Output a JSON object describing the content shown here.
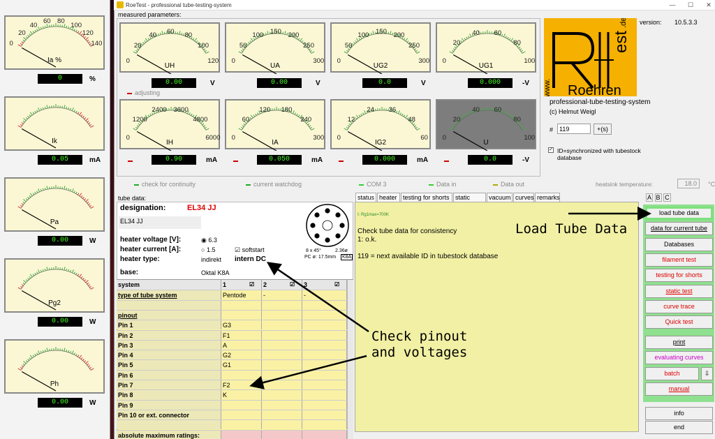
{
  "window": {
    "title": "RoeTest - professional tube-testing-system"
  },
  "left_meters": [
    {
      "label": "Ia %",
      "unit": "%",
      "value": "0",
      "ticks": [
        "0",
        "20",
        "40",
        "60",
        "80",
        "100",
        "120",
        "140"
      ]
    },
    {
      "label": "Ik",
      "unit": "mA",
      "value": "0.05"
    },
    {
      "label": "Pa",
      "unit": "W",
      "value": "0.00"
    },
    {
      "label": "Pg2",
      "unit": "W",
      "value": "0.00"
    },
    {
      "label": "Ph",
      "unit": "W",
      "value": "0.00"
    }
  ],
  "measured": {
    "title": "measured parameters:",
    "meters": [
      {
        "label": "UH",
        "unit": "V",
        "value": "0.00",
        "ticks": [
          "0",
          "20",
          "40",
          "60",
          "80",
          "100",
          "120"
        ]
      },
      {
        "label": "UA",
        "unit": "V",
        "value": "0.00",
        "ticks": [
          "0",
          "50",
          "100",
          "150",
          "200",
          "250",
          "300"
        ]
      },
      {
        "label": "UG2",
        "unit": "V",
        "value": "0.0",
        "ticks": [
          "0",
          "50",
          "100",
          "150",
          "200",
          "250",
          "300"
        ]
      },
      {
        "label": "UG1",
        "unit": "-V",
        "value": "0.000",
        "ticks": [
          "0",
          "20",
          "40",
          "60",
          "80",
          "100"
        ]
      },
      {
        "label": "IH",
        "unit": "mA",
        "value": "0.90",
        "ticks": [
          "0",
          "1200",
          "2400",
          "3600",
          "4800",
          "6000"
        ]
      },
      {
        "label": "IA",
        "unit": "mA",
        "value": "0.050",
        "ticks": [
          "0",
          "60",
          "120",
          "180",
          "240",
          "300"
        ]
      },
      {
        "label": "IG2",
        "unit": "mA",
        "value": "0.000",
        "ticks": [
          "0",
          "12",
          "24",
          "36",
          "48",
          "60"
        ]
      },
      {
        "label": "U",
        "unit": "-V",
        "value": "0.0",
        "ticks": [
          "0",
          "20",
          "40",
          "60",
          "80",
          "100"
        ]
      }
    ],
    "adjusting": "adjusting"
  },
  "logo": {
    "text_de": ".de",
    "text_roehren": "Roehren",
    "text_www": "www.",
    "text_est": "est"
  },
  "version": {
    "label": "version:",
    "value": "10.5.3.3"
  },
  "brand": {
    "line1": "professional-tube-testing-system",
    "line2": "(c) Helmut Weigl"
  },
  "id_field": {
    "hash": "#",
    "value": "119",
    "button": "+(s)"
  },
  "sync": {
    "label": "ID=synchronized with tubestock database"
  },
  "status_leds": {
    "continuity": "check for continuity",
    "watchdog": "current watchdog",
    "com": "COM 3",
    "data_in": "Data in",
    "data_out": "Data out"
  },
  "heatsink": {
    "label": "heatsink temperature:",
    "value": "18.0",
    "unit": "°C"
  },
  "tube": {
    "section": "tube data:",
    "designation_label": "designation:",
    "designation": "EL34 JJ",
    "name": "EL34 JJ",
    "heater_voltage_label": "heater voltage [V]:",
    "heater_current_label": "heater current [A]:",
    "heater_type_label": "heater type:",
    "hv": "6.3",
    "hc": "1.5",
    "indirekt": "indirekt",
    "softstart": "softstart",
    "intern": "intern DC",
    "base_label": "base:",
    "base": "Oktal K8A",
    "socket_text1": "8 x 45°",
    "socket_text2": "2.36ø",
    "socket_text3": "PC ø: 17.5mm",
    "socket_text4": "K8A"
  },
  "grid": {
    "headers": [
      "system",
      "1",
      "2",
      "3"
    ],
    "rows": [
      {
        "name": "type of tube system",
        "c1": "Pentode",
        "c2": "-",
        "c3": "-"
      },
      {
        "name": "",
        "c1": "",
        "c2": "",
        "c3": ""
      },
      {
        "name": "pinout",
        "c1": "",
        "c2": "",
        "c3": ""
      },
      {
        "name": "Pin 1",
        "c1": "G3",
        "c2": "",
        "c3": ""
      },
      {
        "name": "Pin 2",
        "c1": "F1",
        "c2": "",
        "c3": ""
      },
      {
        "name": "Pin 3",
        "c1": "A",
        "c2": "",
        "c3": ""
      },
      {
        "name": "Pin 4",
        "c1": "G2",
        "c2": "",
        "c3": ""
      },
      {
        "name": "Pin 5",
        "c1": "G1",
        "c2": "",
        "c3": ""
      },
      {
        "name": "Pin 6",
        "c1": "",
        "c2": "",
        "c3": ""
      },
      {
        "name": "Pin 7",
        "c1": "F2",
        "c2": "",
        "c3": ""
      },
      {
        "name": "Pin 8",
        "c1": "K",
        "c2": "",
        "c3": ""
      },
      {
        "name": "Pin 9",
        "c1": "",
        "c2": "",
        "c3": ""
      },
      {
        "name": "Pin 10 or ext. connector",
        "c1": "",
        "c2": "",
        "c3": ""
      },
      {
        "name": "",
        "c1": "",
        "c2": "",
        "c3": ""
      },
      {
        "name": "absolute maximum ratings:",
        "c1": "",
        "c2": "",
        "c3": ""
      }
    ]
  },
  "tabs": [
    "status",
    "heater",
    "testing for shorts",
    "static data",
    "vacuum",
    "curves",
    "remarks"
  ],
  "abc": [
    "A",
    "B",
    "C"
  ],
  "status_panel": {
    "small": "I: Rg1max=700K",
    "line1": "Check tube data for consistency",
    "line2": "1: o.k.",
    "line3": "119 = next available ID in tubestock database"
  },
  "buttons": [
    {
      "label": "load tube data",
      "style": "hl"
    },
    {
      "label": "data for current tube",
      "style": ""
    },
    {
      "label": "Databases",
      "style": ""
    },
    {
      "label": "filament test",
      "style": "red"
    },
    {
      "label": "testing for shorts",
      "style": "red"
    },
    {
      "label": "static test",
      "style": "red"
    },
    {
      "label": "curve trace",
      "style": "red"
    },
    {
      "label": "Quick test",
      "style": "red"
    },
    {
      "label": "print",
      "style": ""
    },
    {
      "label": "evaluating curves",
      "style": "mag"
    },
    {
      "label": "batch",
      "style": "red"
    },
    {
      "label": "manual",
      "style": "red"
    },
    {
      "label": "info",
      "style": ""
    },
    {
      "label": "end",
      "style": ""
    }
  ],
  "annotations": {
    "load": "Load Tube Data",
    "check1": "Check pinout",
    "check2": "and voltages"
  }
}
